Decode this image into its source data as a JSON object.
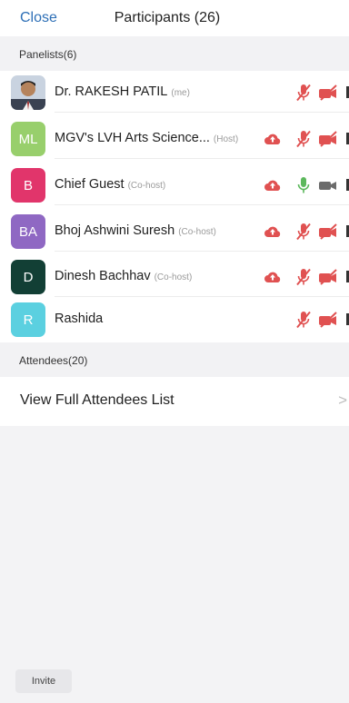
{
  "header": {
    "close_label": "Close",
    "title": "Participants (26)"
  },
  "panelists_header": "Panelists(6)",
  "attendees_header": "Attendees(20)",
  "panelists": [
    {
      "name": "Dr. RAKESH PATIL",
      "role": "(me)",
      "initials": "",
      "avatar_color": "#6a6a6a",
      "photo": true,
      "cloud": false,
      "mic": "muted",
      "video": "off"
    },
    {
      "name": "MGV's LVH Arts Science...",
      "role": "(Host)",
      "initials": "ML",
      "avatar_color": "#98cf6c",
      "photo": false,
      "cloud": true,
      "mic": "muted",
      "video": "off"
    },
    {
      "name": "Chief Guest",
      "role": "(Co-host)",
      "initials": "B",
      "avatar_color": "#e1356b",
      "photo": false,
      "cloud": true,
      "mic": "on",
      "video": "on"
    },
    {
      "name": "Bhoj Ashwini Suresh",
      "role": "(Co-host)",
      "initials": "BA",
      "avatar_color": "#8f68c3",
      "photo": false,
      "cloud": true,
      "mic": "muted",
      "video": "off"
    },
    {
      "name": "Dinesh Bachhav",
      "role": "(Co-host)",
      "initials": "D",
      "avatar_color": "#123f35",
      "photo": false,
      "cloud": true,
      "mic": "muted",
      "video": "off"
    },
    {
      "name": "Rashida",
      "role": "",
      "initials": "R",
      "avatar_color": "#5bd0e0",
      "photo": false,
      "cloud": false,
      "mic": "muted",
      "video": "off"
    }
  ],
  "attendees": {
    "view_label": "View Full Attendees List",
    "chevron": ">"
  },
  "footer": {
    "invite_label": "Invite"
  },
  "colors": {
    "accent": "#2d6fb6",
    "muted_red": "#e05151",
    "mic_on_green": "#5cb85c",
    "video_on_gray": "#6b6b6b"
  }
}
